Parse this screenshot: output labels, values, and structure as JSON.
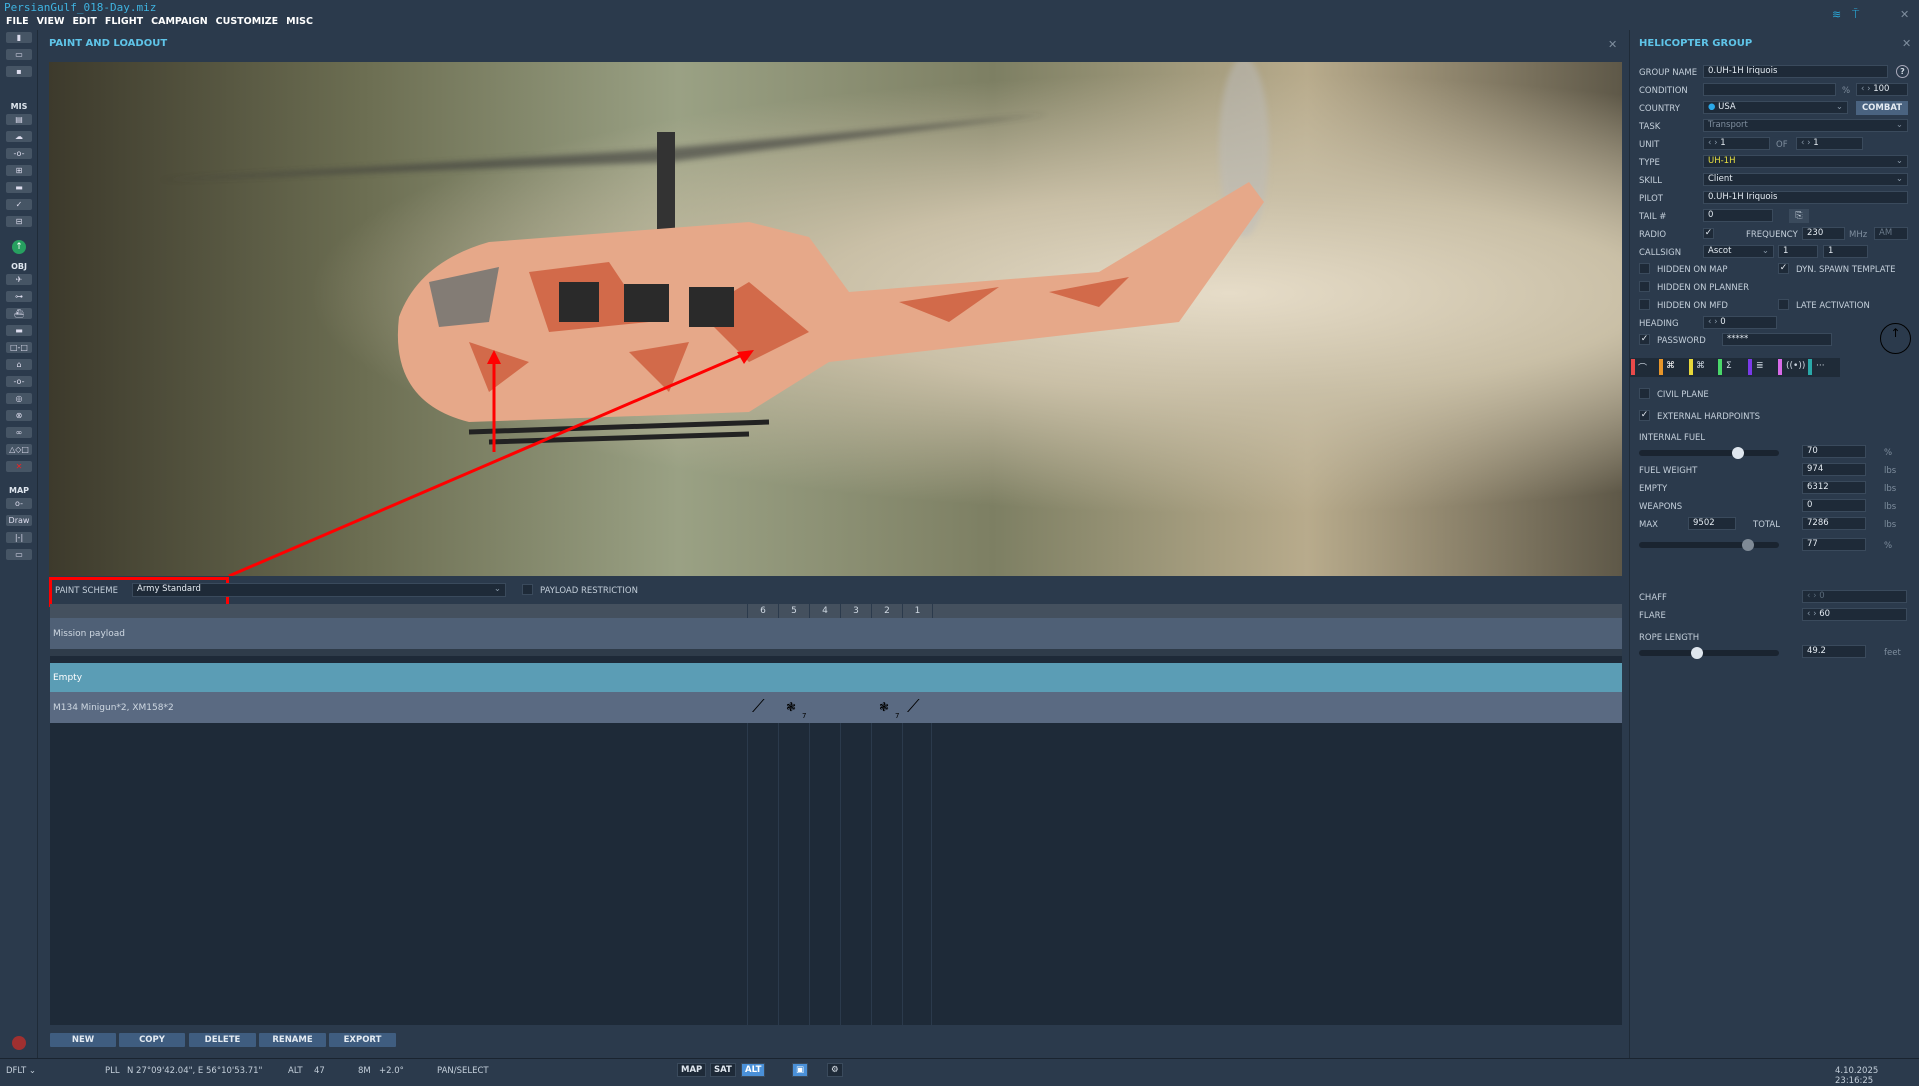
{
  "window": {
    "title": "PersianGulf_018-Day.miz"
  },
  "menu": [
    "FILE",
    "VIEW",
    "EDIT",
    "FLIGHT",
    "CAMPAIGN",
    "CUSTOMIZE",
    "MISC"
  ],
  "toolbar": {
    "sections": {
      "mis": "MIS",
      "obj": "OBJ",
      "map": "MAP"
    },
    "draw": "Draw"
  },
  "loadout": {
    "title": "PAINT AND LOADOUT",
    "paint_scheme_label": "PAINT SCHEME",
    "paint_scheme_value": "Army Standard",
    "payload_restriction": "PAYLOAD RESTRICTION",
    "stations": [
      "6",
      "5",
      "4",
      "3",
      "2",
      "1"
    ],
    "rows": [
      {
        "name": "Mission payload"
      },
      {
        "name": "Empty"
      },
      {
        "name": "M134 Minigun*2, XM158*2",
        "counts": [
          "7",
          "7"
        ]
      }
    ],
    "buttons": [
      "NEW",
      "COPY",
      "DELETE",
      "RENAME",
      "EXPORT"
    ]
  },
  "group": {
    "title": "HELICOPTER GROUP",
    "group_name_label": "GROUP NAME",
    "group_name": "0.UH-1H Iriquois",
    "help": "?",
    "condition_label": "CONDITION",
    "condition_unit": "%",
    "condition": "100",
    "country_label": "COUNTRY",
    "country": "USA",
    "combat": "COMBAT",
    "task_label": "TASK",
    "task": "Transport",
    "unit_label": "UNIT",
    "unit": "1",
    "of_label": "OF",
    "of": "1",
    "type_label": "TYPE",
    "type": "UH-1H",
    "skill_label": "SKILL",
    "skill": "Client",
    "pilot_label": "PILOT",
    "pilot": "0.UH-1H Iriquois",
    "tail_label": "TAIL #",
    "tail": "0",
    "radio_label": "RADIO",
    "frequency_label": "FREQUENCY",
    "frequency": "230",
    "mhz": "MHz",
    "modulation": "AM",
    "callsign_label": "CALLSIGN",
    "callsign": "Ascot",
    "callsign_n1": "1",
    "callsign_n2": "1",
    "hidden_map": "HIDDEN ON MAP",
    "dyn_spawn": "DYN. SPAWN TEMPLATE",
    "hidden_planner": "HIDDEN ON PLANNER",
    "hidden_mfd": "HIDDEN ON MFD",
    "late_activation": "LATE ACTIVATION",
    "heading_label": "HEADING",
    "heading": "0",
    "password_label": "PASSWORD",
    "password": "*****",
    "tab_colors": [
      "#e84a4a",
      "#e8962a",
      "#e8d83a",
      "#4ad86a",
      "#7a3ae8",
      "#d86ae8",
      "#2aa8a8"
    ],
    "civil_plane": "CIVIL PLANE",
    "external_hardpoints": "EXTERNAL HARDPOINTS",
    "internal_fuel_label": "INTERNAL FUEL",
    "internal_fuel": "70",
    "pct": "%",
    "fuel_weight_label": "FUEL WEIGHT",
    "fuel_weight": "974",
    "empty_label": "EMPTY",
    "empty": "6312",
    "weapons_label": "WEAPONS",
    "weapons": "0",
    "max_label": "MAX",
    "max": "9502",
    "total_label": "TOTAL",
    "total": "7286",
    "total_pct": "77",
    "lbs": "lbs",
    "chaff_label": "CHAFF",
    "chaff": "0",
    "flare_label": "FLARE",
    "flare": "60",
    "rope_label": "ROPE LENGTH",
    "rope": "49.2",
    "feet": "feet"
  },
  "status": {
    "profile": "DFLT",
    "pll": "PLL",
    "coords": "N 27°09'42.04\", E 56°10'53.71\"",
    "alt_label": "ALT",
    "alt": "47",
    "scale": "8M",
    "angle": "+2.0°",
    "mode": "PAN/SELECT",
    "map": "MAP",
    "sat": "SAT",
    "alt_btn": "ALT",
    "datetime": "4.10.2025 23:16:25"
  }
}
